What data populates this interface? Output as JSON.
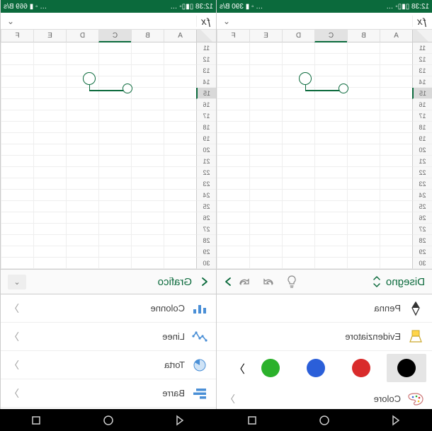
{
  "left": {
    "status": {
      "left": "12:38 ▯▮▯◦ …",
      "right": "… ◦ ▮ 390 B/s"
    },
    "ribbon": {
      "title": "Disegno"
    },
    "options": {
      "pen": "Penna",
      "highlighter": "Evidenziatore",
      "color": "Colore"
    },
    "swatches": [
      "#000000",
      "#d92b2b",
      "#2b5fd9",
      "#2bb12b"
    ],
    "cols": [
      "A",
      "B",
      "C",
      "D",
      "E",
      "F"
    ],
    "rows": [
      "11",
      "12",
      "13",
      "14",
      "15",
      "16",
      "17",
      "18",
      "19",
      "20",
      "21",
      "22",
      "23",
      "24",
      "25",
      "26",
      "27",
      "28",
      "29",
      "30"
    ],
    "selectedCol": "C",
    "selectedRow": "15"
  },
  "right": {
    "status": {
      "left": "12:38 ▯▮▯◦ …",
      "right": "… ◦ ▮ 669 B/s"
    },
    "ribbon": {
      "title": "Grafico"
    },
    "options": {
      "columns": "Colonne",
      "lines": "Linee",
      "pie": "Torta",
      "bars": "Barre"
    },
    "cols": [
      "A",
      "B",
      "C",
      "D",
      "E",
      "F"
    ],
    "rows": [
      "11",
      "12",
      "13",
      "14",
      "15",
      "16",
      "17",
      "18",
      "19",
      "20",
      "21",
      "22",
      "23",
      "24",
      "25",
      "26",
      "27",
      "28",
      "29",
      "30"
    ],
    "selectedCol": "C",
    "selectedRow": "15"
  }
}
